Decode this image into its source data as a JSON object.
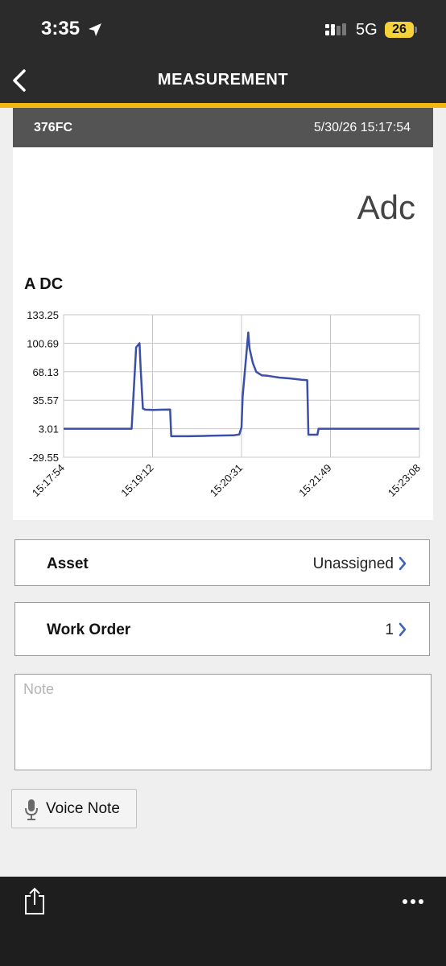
{
  "status_bar": {
    "time": "3:35",
    "network": "5G",
    "battery": "26"
  },
  "nav": {
    "title": "MEASUREMENT"
  },
  "measurement": {
    "device_id": "376FC",
    "timestamp": "5/30/26 15:17:54",
    "unit": "Adc"
  },
  "chart_data": {
    "type": "line",
    "title": "A DC",
    "ylim": [
      -29.55,
      133.25
    ],
    "y_ticks": [
      "133.25",
      "100.69",
      "68.13",
      "35.57",
      "3.01",
      "-29.55"
    ],
    "x_tick_labels": [
      "15:17:54",
      "15:19:12",
      "15:20:31",
      "15:21:49",
      "15:23:08"
    ],
    "xlim_seconds": [
      0,
      314
    ],
    "grid": true,
    "color": "#3b4fa8",
    "series": [
      {
        "x": [
          0,
          60,
          64,
          67,
          68,
          70,
          71,
          72,
          79,
          88,
          94,
          95,
          100,
          110,
          130,
          150,
          155,
          157,
          158,
          163,
          164,
          167,
          170,
          175,
          180,
          190,
          200,
          210,
          215,
          216,
          224,
          225,
          240,
          260,
          280,
          314
        ],
        "y": [
          3.0,
          3.0,
          96.0,
          100.69,
          72.0,
          26.0,
          25.5,
          24.8,
          24.5,
          24.8,
          25.0,
          -5.5,
          -5.5,
          -5.5,
          -5.0,
          -4.5,
          -3.5,
          4.8,
          40.0,
          113.0,
          95.0,
          78.0,
          68.0,
          64.0,
          63.5,
          61.5,
          60.5,
          59.0,
          58.5,
          -3.8,
          -3.8,
          3.0,
          3.0,
          3.0,
          3.0,
          3.0
        ]
      }
    ]
  },
  "asset": {
    "label": "Asset",
    "value": "Unassigned"
  },
  "work_order": {
    "label": "Work Order",
    "value": "1"
  },
  "note": {
    "placeholder": "Note",
    "value": ""
  },
  "voice_note": {
    "label": "Voice Note"
  },
  "toolbar": {
    "share_icon": "share-icon",
    "more_icon": "more-icon"
  }
}
